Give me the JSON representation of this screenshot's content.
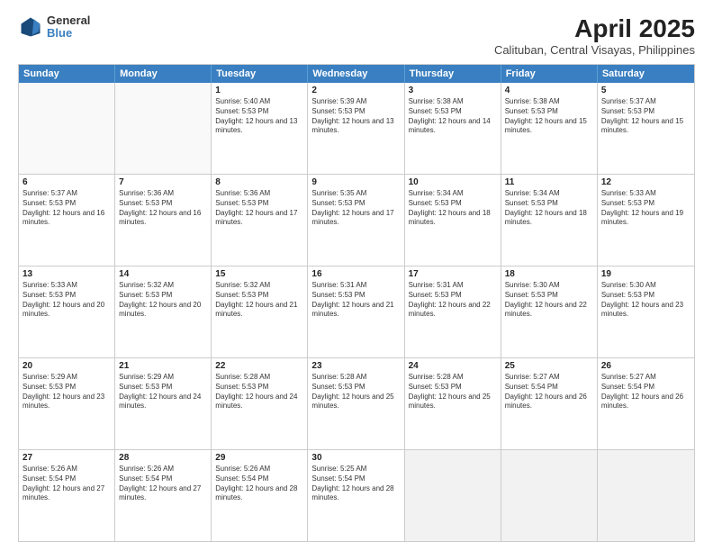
{
  "header": {
    "logo": {
      "line1": "General",
      "line2": "Blue"
    },
    "title": "April 2025",
    "subtitle": "Calituban, Central Visayas, Philippines"
  },
  "weekdays": [
    "Sunday",
    "Monday",
    "Tuesday",
    "Wednesday",
    "Thursday",
    "Friday",
    "Saturday"
  ],
  "rows": [
    [
      {
        "day": "",
        "sunrise": "",
        "sunset": "",
        "daylight": "",
        "empty": true
      },
      {
        "day": "",
        "sunrise": "",
        "sunset": "",
        "daylight": "",
        "empty": true
      },
      {
        "day": "1",
        "sunrise": "Sunrise: 5:40 AM",
        "sunset": "Sunset: 5:53 PM",
        "daylight": "Daylight: 12 hours and 13 minutes."
      },
      {
        "day": "2",
        "sunrise": "Sunrise: 5:39 AM",
        "sunset": "Sunset: 5:53 PM",
        "daylight": "Daylight: 12 hours and 13 minutes."
      },
      {
        "day": "3",
        "sunrise": "Sunrise: 5:38 AM",
        "sunset": "Sunset: 5:53 PM",
        "daylight": "Daylight: 12 hours and 14 minutes."
      },
      {
        "day": "4",
        "sunrise": "Sunrise: 5:38 AM",
        "sunset": "Sunset: 5:53 PM",
        "daylight": "Daylight: 12 hours and 15 minutes."
      },
      {
        "day": "5",
        "sunrise": "Sunrise: 5:37 AM",
        "sunset": "Sunset: 5:53 PM",
        "daylight": "Daylight: 12 hours and 15 minutes."
      }
    ],
    [
      {
        "day": "6",
        "sunrise": "Sunrise: 5:37 AM",
        "sunset": "Sunset: 5:53 PM",
        "daylight": "Daylight: 12 hours and 16 minutes."
      },
      {
        "day": "7",
        "sunrise": "Sunrise: 5:36 AM",
        "sunset": "Sunset: 5:53 PM",
        "daylight": "Daylight: 12 hours and 16 minutes."
      },
      {
        "day": "8",
        "sunrise": "Sunrise: 5:36 AM",
        "sunset": "Sunset: 5:53 PM",
        "daylight": "Daylight: 12 hours and 17 minutes."
      },
      {
        "day": "9",
        "sunrise": "Sunrise: 5:35 AM",
        "sunset": "Sunset: 5:53 PM",
        "daylight": "Daylight: 12 hours and 17 minutes."
      },
      {
        "day": "10",
        "sunrise": "Sunrise: 5:34 AM",
        "sunset": "Sunset: 5:53 PM",
        "daylight": "Daylight: 12 hours and 18 minutes."
      },
      {
        "day": "11",
        "sunrise": "Sunrise: 5:34 AM",
        "sunset": "Sunset: 5:53 PM",
        "daylight": "Daylight: 12 hours and 18 minutes."
      },
      {
        "day": "12",
        "sunrise": "Sunrise: 5:33 AM",
        "sunset": "Sunset: 5:53 PM",
        "daylight": "Daylight: 12 hours and 19 minutes."
      }
    ],
    [
      {
        "day": "13",
        "sunrise": "Sunrise: 5:33 AM",
        "sunset": "Sunset: 5:53 PM",
        "daylight": "Daylight: 12 hours and 20 minutes."
      },
      {
        "day": "14",
        "sunrise": "Sunrise: 5:32 AM",
        "sunset": "Sunset: 5:53 PM",
        "daylight": "Daylight: 12 hours and 20 minutes."
      },
      {
        "day": "15",
        "sunrise": "Sunrise: 5:32 AM",
        "sunset": "Sunset: 5:53 PM",
        "daylight": "Daylight: 12 hours and 21 minutes."
      },
      {
        "day": "16",
        "sunrise": "Sunrise: 5:31 AM",
        "sunset": "Sunset: 5:53 PM",
        "daylight": "Daylight: 12 hours and 21 minutes."
      },
      {
        "day": "17",
        "sunrise": "Sunrise: 5:31 AM",
        "sunset": "Sunset: 5:53 PM",
        "daylight": "Daylight: 12 hours and 22 minutes."
      },
      {
        "day": "18",
        "sunrise": "Sunrise: 5:30 AM",
        "sunset": "Sunset: 5:53 PM",
        "daylight": "Daylight: 12 hours and 22 minutes."
      },
      {
        "day": "19",
        "sunrise": "Sunrise: 5:30 AM",
        "sunset": "Sunset: 5:53 PM",
        "daylight": "Daylight: 12 hours and 23 minutes."
      }
    ],
    [
      {
        "day": "20",
        "sunrise": "Sunrise: 5:29 AM",
        "sunset": "Sunset: 5:53 PM",
        "daylight": "Daylight: 12 hours and 23 minutes."
      },
      {
        "day": "21",
        "sunrise": "Sunrise: 5:29 AM",
        "sunset": "Sunset: 5:53 PM",
        "daylight": "Daylight: 12 hours and 24 minutes."
      },
      {
        "day": "22",
        "sunrise": "Sunrise: 5:28 AM",
        "sunset": "Sunset: 5:53 PM",
        "daylight": "Daylight: 12 hours and 24 minutes."
      },
      {
        "day": "23",
        "sunrise": "Sunrise: 5:28 AM",
        "sunset": "Sunset: 5:53 PM",
        "daylight": "Daylight: 12 hours and 25 minutes."
      },
      {
        "day": "24",
        "sunrise": "Sunrise: 5:28 AM",
        "sunset": "Sunset: 5:53 PM",
        "daylight": "Daylight: 12 hours and 25 minutes."
      },
      {
        "day": "25",
        "sunrise": "Sunrise: 5:27 AM",
        "sunset": "Sunset: 5:54 PM",
        "daylight": "Daylight: 12 hours and 26 minutes."
      },
      {
        "day": "26",
        "sunrise": "Sunrise: 5:27 AM",
        "sunset": "Sunset: 5:54 PM",
        "daylight": "Daylight: 12 hours and 26 minutes."
      }
    ],
    [
      {
        "day": "27",
        "sunrise": "Sunrise: 5:26 AM",
        "sunset": "Sunset: 5:54 PM",
        "daylight": "Daylight: 12 hours and 27 minutes."
      },
      {
        "day": "28",
        "sunrise": "Sunrise: 5:26 AM",
        "sunset": "Sunset: 5:54 PM",
        "daylight": "Daylight: 12 hours and 27 minutes."
      },
      {
        "day": "29",
        "sunrise": "Sunrise: 5:26 AM",
        "sunset": "Sunset: 5:54 PM",
        "daylight": "Daylight: 12 hours and 28 minutes."
      },
      {
        "day": "30",
        "sunrise": "Sunrise: 5:25 AM",
        "sunset": "Sunset: 5:54 PM",
        "daylight": "Daylight: 12 hours and 28 minutes."
      },
      {
        "day": "",
        "sunrise": "",
        "sunset": "",
        "daylight": "",
        "empty": true
      },
      {
        "day": "",
        "sunrise": "",
        "sunset": "",
        "daylight": "",
        "empty": true
      },
      {
        "day": "",
        "sunrise": "",
        "sunset": "",
        "daylight": "",
        "empty": true
      }
    ]
  ]
}
